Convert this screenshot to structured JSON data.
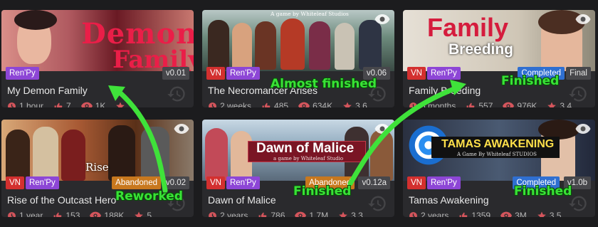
{
  "cards": [
    {
      "title": "My Demon Family",
      "tags": [
        "Ren'Py"
      ],
      "status": "",
      "version": "v0.01",
      "logo": "Demon",
      "logo_sub": "Family",
      "time": "1 hour",
      "likes": "7",
      "views": "1K",
      "rating": "",
      "colors": {
        "bg1": "#d88a86",
        "bg2": "#6a1a24",
        "logo": "#e01840"
      }
    },
    {
      "title": "The Necromancer Arises",
      "tags": [
        "VN",
        "Ren'Py"
      ],
      "status": "",
      "version": "v0.06",
      "logo": "",
      "logo_sub": "A game by Whiteleaf Studios",
      "time": "2 weeks",
      "likes": "485",
      "views": "634K",
      "rating": "3.6",
      "colors": {
        "bg1": "#5c7a6a",
        "bg2": "#2f3a3a",
        "logo": "#ffffff"
      }
    },
    {
      "title": "Family Breeding",
      "tags": [
        "VN",
        "Ren'Py"
      ],
      "status": "Completed",
      "version": "Final",
      "logo": "Family",
      "logo_sub": "Breeding",
      "time": "5 months",
      "likes": "557",
      "views": "976K",
      "rating": "3.4",
      "colors": {
        "bg1": "#d8d0c4",
        "bg2": "#8e8878",
        "logo": "#d21a3a"
      }
    },
    {
      "title": "Rise of the Outcast Hero",
      "tags": [
        "VN",
        "Ren'Py"
      ],
      "status": "Abandoned",
      "version": "v0.02",
      "logo": "Rise",
      "logo_sub": "",
      "time": "1 year",
      "likes": "153",
      "views": "188K",
      "rating": "5",
      "colors": {
        "bg1": "#c7905a",
        "bg2": "#5a3018",
        "logo": "#ffffff"
      }
    },
    {
      "title": "Dawn of Malice",
      "tags": [
        "VN",
        "Ren'Py"
      ],
      "status": "Abandoned",
      "version": "v0.12a",
      "logo": "Dawn of Malice",
      "logo_sub": "a game by Whiteleaf Studio",
      "time": "2 years",
      "likes": "786",
      "views": "1.7M",
      "rating": "3.3",
      "colors": {
        "bg1": "#9bb6c8",
        "bg2": "#b03a48",
        "logo": "#ffffff"
      }
    },
    {
      "title": "Tamas Awakening",
      "tags": [
        "VN",
        "Ren'Py"
      ],
      "status": "Completed",
      "version": "v1.0b",
      "logo": "TAMAS AWAKENING",
      "logo_sub": "A Game By Whiteleaf STUDIOS",
      "time": "2 years",
      "likes": "1359",
      "views": "3M",
      "rating": "3.5",
      "colors": {
        "bg1": "#4a5a72",
        "bg2": "#22283a",
        "logo": "#ffe04a"
      }
    }
  ],
  "annotations": {
    "almost_finished": "Almost finished",
    "finished_1": "Finished",
    "reworked": "Reworked",
    "finished_2": "Finished",
    "finished_3": "Finished"
  },
  "icons": {
    "time": "clock-icon",
    "likes": "thumbs-up-icon",
    "views": "eye-icon",
    "rating": "star-icon",
    "watch": "eye-icon",
    "history": "history-icon"
  }
}
